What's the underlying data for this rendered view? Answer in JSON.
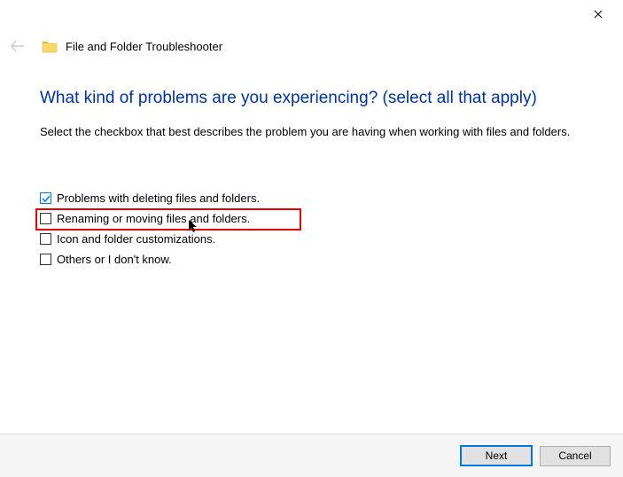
{
  "window": {
    "title": "File and Folder Troubleshooter"
  },
  "page": {
    "heading": "What kind of problems are you experiencing? (select all that apply)",
    "description": "Select the checkbox that best describes the problem you are having when working with files and folders."
  },
  "options": [
    {
      "label": "Problems with deleting files and folders.",
      "checked": true
    },
    {
      "label": "Renaming or moving files and folders.",
      "checked": false
    },
    {
      "label": "Icon and folder customizations.",
      "checked": false
    },
    {
      "label": "Others or I don't know.",
      "checked": false
    }
  ],
  "buttons": {
    "next": "Next",
    "cancel": "Cancel"
  }
}
